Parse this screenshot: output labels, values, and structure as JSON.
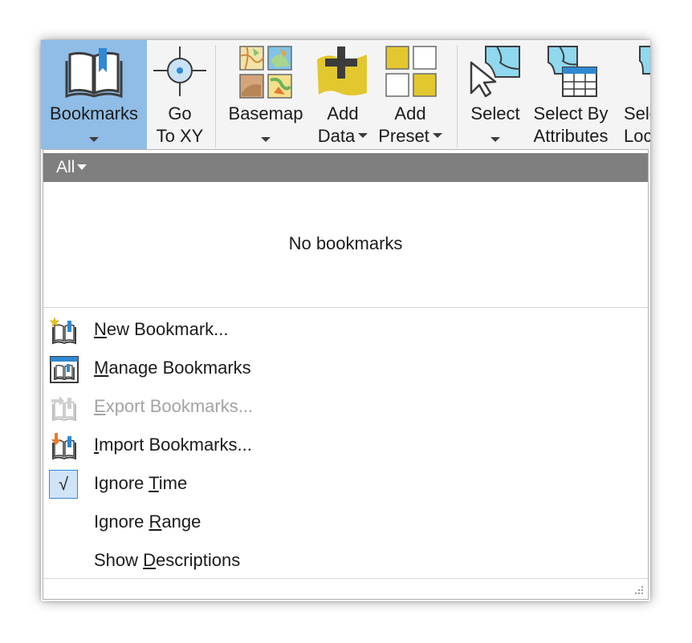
{
  "ribbon": {
    "buttons": [
      {
        "id": "bookmarks",
        "line1": "Bookmarks",
        "line2": "",
        "has_caret": true,
        "active": true,
        "icon": "bookmarks-book-icon"
      },
      {
        "id": "goto-xy",
        "line1": "Go",
        "line2": "To XY",
        "has_caret": false,
        "icon": "crosshair-icon"
      },
      {
        "id": "basemap",
        "line1": "Basemap",
        "line2": "",
        "has_caret": true,
        "icon": "basemap-tiles-icon"
      },
      {
        "id": "add-data",
        "line1": "Add",
        "line2": "Data",
        "has_caret": true,
        "icon": "add-data-icon"
      },
      {
        "id": "add-preset",
        "line1": "Add",
        "line2": "Preset",
        "has_caret": true,
        "icon": "add-preset-icon"
      },
      {
        "id": "select",
        "line1": "Select",
        "line2": "",
        "has_caret": true,
        "icon": "select-cursor-icon"
      },
      {
        "id": "select-by-attributes",
        "line1": "Select By",
        "line2": "Attributes",
        "has_caret": false,
        "icon": "select-table-icon"
      },
      {
        "id": "select-by-location",
        "line1": "Sele",
        "line2": "Loc",
        "has_caret": false,
        "icon": "select-location-icon"
      }
    ]
  },
  "bookmarks_panel": {
    "filter_label": "All",
    "empty_message": "No bookmarks",
    "menu": [
      {
        "label_pre": "",
        "label_key": "N",
        "label_post": "ew Bookmark...",
        "enabled": true,
        "icon": "new-bookmark-icon"
      },
      {
        "label_pre": "",
        "label_key": "M",
        "label_post": "anage Bookmarks",
        "enabled": true,
        "icon": "manage-bookmarks-icon"
      },
      {
        "label_pre": "",
        "label_key": "E",
        "label_post": "xport Bookmarks...",
        "enabled": false,
        "icon": "export-bookmarks-icon"
      },
      {
        "label_pre": "",
        "label_key": "I",
        "label_post": "mport Bookmarks...",
        "enabled": true,
        "icon": "import-bookmarks-icon"
      },
      {
        "label_pre": "Ignore ",
        "label_key": "T",
        "label_post": "ime",
        "enabled": true,
        "checked": true,
        "check_glyph": "√"
      },
      {
        "label_pre": "Ignore ",
        "label_key": "R",
        "label_post": "ange",
        "enabled": true,
        "checked": false
      },
      {
        "label_pre": "Show ",
        "label_key": "D",
        "label_post": "escriptions",
        "enabled": true,
        "checked": false
      }
    ]
  },
  "colors": {
    "active_button": "#8fbde6",
    "filter_bar": "#7f7f7f",
    "accent_blue": "#2f88d4",
    "disabled_text": "#a3a3a3"
  }
}
